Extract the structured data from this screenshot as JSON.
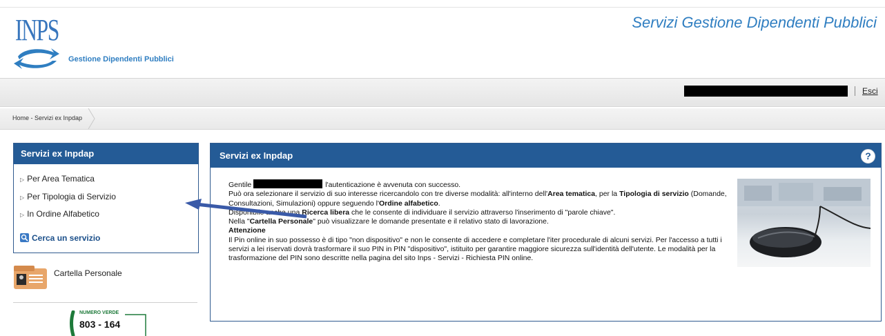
{
  "header": {
    "logo_text": "INPS",
    "logo_subtitle": "Gestione Dipendenti Pubblici",
    "app_title": "Servizi Gestione Dipendenti Pubblici"
  },
  "userbar": {
    "logout_label": "Esci"
  },
  "breadcrumb": {
    "text": "Home - Servizi ex Inpdap"
  },
  "sidebar": {
    "title": "Servizi ex Inpdap",
    "items": [
      {
        "label": "Per Area Tematica"
      },
      {
        "label": "Per Tipologia di Servizio"
      },
      {
        "label": "In Ordine Alfabetico"
      }
    ],
    "search_label": "Cerca un servizio",
    "cartella_label": "Cartella Personale",
    "numero_verde_label": "NUMERO VERDE",
    "numero_verde_number": "803 - 164"
  },
  "main": {
    "title": "Servizi ex Inpdap",
    "help_label": "?",
    "greeting_prefix": "Gentile",
    "greeting_suffix": "l'autenticazione è avvenuta con successo.",
    "l2_a": "Può ora selezionare il servizio di suo interesse ricercandolo con tre diverse modalità: all'interno dell'",
    "l2_b": "Area tematica",
    "l2_c": ", per la ",
    "l2_d": "Tipologia di servizio",
    "l2_e": " (Domande, Consultazioni, Simulazioni) oppure seguendo l'",
    "l2_f": "Ordine alfabetico",
    "l2_g": ".",
    "l3_a": "Disponibile anche una ",
    "l3_b": "Ricerca libera",
    "l3_c": " che le consente di individuare il servizio attraverso l'inserimento di \"parole chiave\".",
    "l4_a": "Nella \"",
    "l4_b": "Cartella Personale",
    "l4_c": "\" può visualizzare le domande presentate e il relativo stato di lavorazione.",
    "attention_title": "Attenzione",
    "attention_text": "Il Pin online in suo possesso è di tipo \"non dispositivo\" e non le consente di accedere e completare l'iter procedurale di alcuni servizi. Per l'accesso a tutti i servizi a lei riservati dovrà trasformare il suo PIN in PIN \"dispositivo\", istituito per garantire maggiore sicurezza sull'identità dell'utente. Le modalità per la trasformazione del PIN sono descritte nella pagina del sito Inps - Servizi - Richiesta PIN online."
  },
  "colors": {
    "header_blue": "#245b96",
    "title_blue": "#2f7ec1",
    "annotation_arrow": "#3a5aa8"
  }
}
